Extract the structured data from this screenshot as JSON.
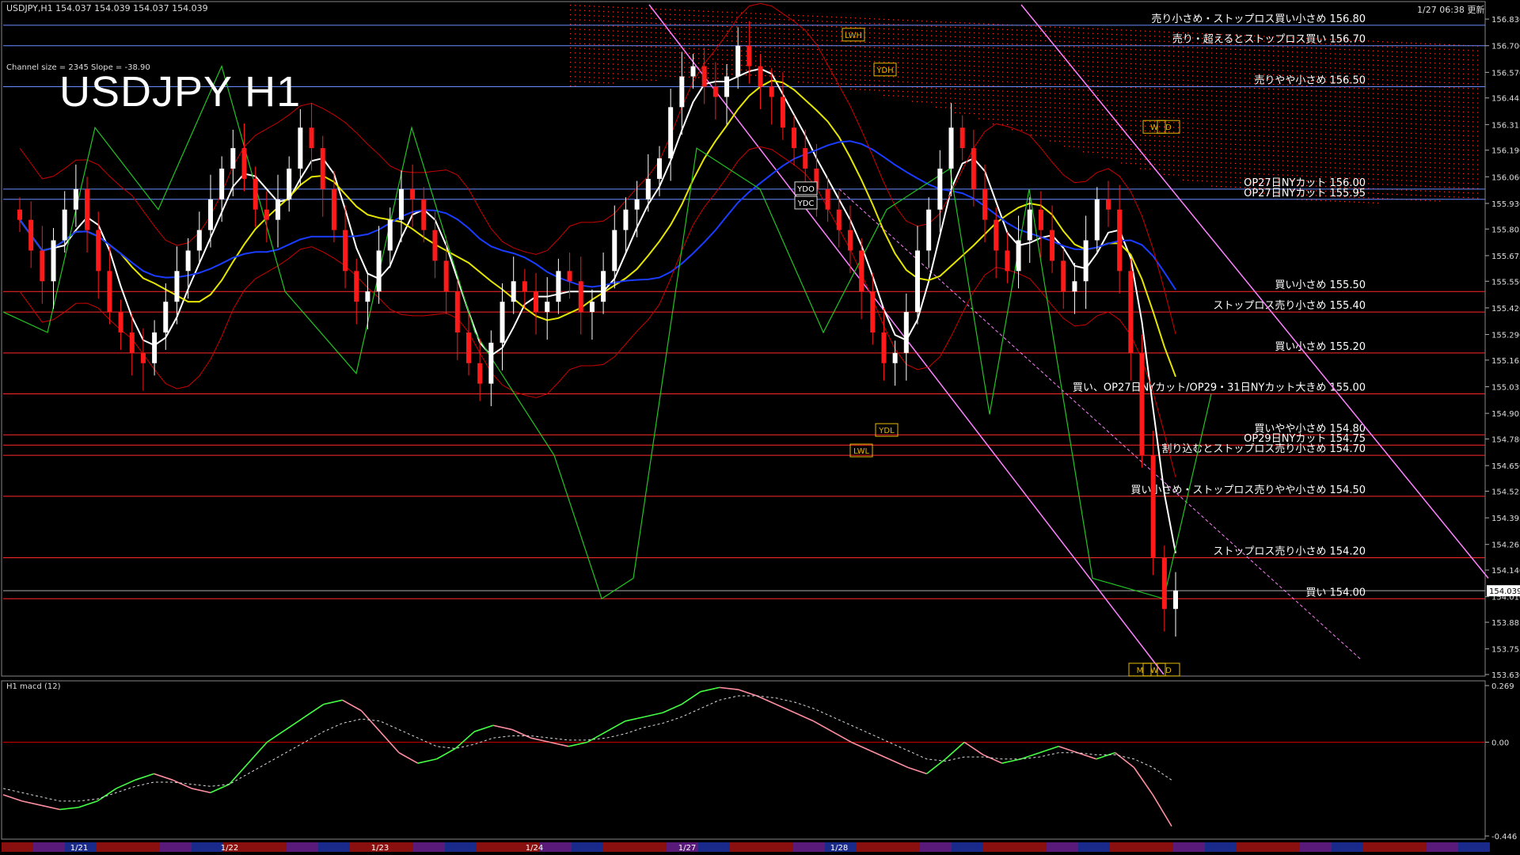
{
  "header": {
    "symbol_info": "USDJPY,H1  154.037 154.039 154.037 154.039",
    "channel_info": "Channel size = 2345 Slope = -38.90",
    "updated": "1/27 06:38 更新",
    "big_title": "USDJPY H1",
    "macd_title": "H1  macd (12)"
  },
  "colors": {
    "background": "#000000",
    "bull": "#ffffff",
    "bear": "#ff1a1a",
    "ichimoku_cloud": "#ff3020",
    "grid": "#1e3a78",
    "ma_white": "#ffffff",
    "ma_yellow": "#e6e600",
    "ma_blue": "#1a3cff",
    "bollinger": "#cc0000",
    "green_line": "#22c422",
    "channel": "#ff80ff",
    "macd_up": "#44ff44",
    "macd_down": "#ff8fa0"
  },
  "chart_data": {
    "type": "candlestick",
    "title": "USDJPY H1",
    "ylim": [
      153.63,
      156.9
    ],
    "y_ticks": [
      "156.830",
      "156.700",
      "156.570",
      "156.445",
      "156.315",
      "156.190",
      "156.060",
      "155.930",
      "155.805",
      "155.675",
      "155.550",
      "155.420",
      "155.290",
      "155.165",
      "155.035",
      "154.905",
      "154.780",
      "154.650",
      "154.525",
      "154.395",
      "154.265",
      "154.140",
      "154.010",
      "153.885",
      "153.755",
      "153.630"
    ],
    "current_price": "154.039",
    "x_labels": [
      "1/21",
      "1/22",
      "1/23",
      "1/24",
      "1/27",
      "1/28"
    ],
    "levels": [
      {
        "price": 156.8,
        "label": "売り小さめ・ストップロス買い小さめ 156.80",
        "color": "#6a8cff"
      },
      {
        "price": 156.7,
        "label": "売り・超えるとストップロス買い 156.70",
        "color": "#6a8cff"
      },
      {
        "price": 156.5,
        "label": "売りやや小さめ 156.50",
        "color": "#6a8cff"
      },
      {
        "price": 156.0,
        "label": "OP27日NYカット 156.00",
        "color": "#6a8cff"
      },
      {
        "price": 155.95,
        "label": "OP27日NYカット 155.95",
        "color": "#6a8cff"
      },
      {
        "price": 155.5,
        "label": "買い小さめ 155.50",
        "color": "#ff2a2a"
      },
      {
        "price": 155.4,
        "label": "ストップロス売り小さめ 155.40",
        "color": "#ff2a2a"
      },
      {
        "price": 155.2,
        "label": "買い小さめ 155.20",
        "color": "#ff2a2a"
      },
      {
        "price": 155.0,
        "label": "買い、OP27日NYカット/OP29・31日NYカット大きめ 155.00",
        "color": "#ff2a2a"
      },
      {
        "price": 154.8,
        "label": "買いやや小さめ 154.80",
        "color": "#ff2a2a"
      },
      {
        "price": 154.75,
        "label": "OP29日NYカット 154.75",
        "color": "#ff2a2a"
      },
      {
        "price": 154.7,
        "label": "割り込むとストップロス売り小さめ 154.70",
        "color": "#ff2a2a"
      },
      {
        "price": 154.5,
        "label": "買い小さめ・ストップロス売りやや小さめ 154.50",
        "color": "#ff2a2a"
      },
      {
        "price": 154.2,
        "label": "ストップロス売り小さめ 154.20",
        "color": "#ff2a2a"
      },
      {
        "price": 154.0,
        "label": "買い 154.00",
        "color": "#ff2a2a"
      }
    ],
    "markers": [
      "LWH",
      "YDH",
      "YDO",
      "YDC",
      "YDL",
      "LWL",
      "W",
      "D",
      "M",
      "W",
      "D"
    ],
    "series_closes": [
      155.85,
      155.7,
      155.55,
      155.75,
      155.9,
      156.0,
      155.8,
      155.6,
      155.4,
      155.3,
      155.2,
      155.15,
      155.3,
      155.45,
      155.6,
      155.7,
      155.8,
      155.95,
      156.1,
      156.2,
      156.05,
      155.9,
      155.85,
      155.95,
      156.1,
      156.3,
      156.2,
      156.0,
      155.8,
      155.6,
      155.45,
      155.5,
      155.7,
      155.85,
      156.0,
      155.95,
      155.8,
      155.65,
      155.5,
      155.3,
      155.15,
      155.05,
      155.25,
      155.45,
      155.55,
      155.5,
      155.4,
      155.45,
      155.6,
      155.55,
      155.4,
      155.45,
      155.6,
      155.8,
      155.9,
      155.95,
      156.05,
      156.15,
      156.4,
      156.55,
      156.6,
      156.5,
      156.45,
      156.55,
      156.7,
      156.6,
      156.5,
      156.45,
      156.3,
      156.2,
      156.1,
      156.0,
      155.9,
      155.8,
      155.7,
      155.5,
      155.3,
      155.15,
      155.2,
      155.4,
      155.7,
      155.9,
      156.1,
      156.3,
      156.2,
      156.0,
      155.85,
      155.7,
      155.6,
      155.75,
      155.9,
      155.8,
      155.65,
      155.5,
      155.55,
      155.75,
      155.95,
      155.9,
      155.6,
      155.2,
      154.7,
      154.2,
      153.95,
      154.04
    ],
    "macd": {
      "ylim": [
        -0.446,
        0.269
      ],
      "y_ticks": [
        "0.269",
        "0.00",
        "-0.446"
      ],
      "values": [
        -0.25,
        -0.28,
        -0.3,
        -0.32,
        -0.31,
        -0.28,
        -0.22,
        -0.18,
        -0.15,
        -0.18,
        -0.22,
        -0.24,
        -0.2,
        -0.1,
        0.0,
        0.06,
        0.12,
        0.18,
        0.2,
        0.15,
        0.05,
        -0.05,
        -0.1,
        -0.08,
        -0.03,
        0.05,
        0.08,
        0.06,
        0.02,
        0.0,
        -0.02,
        0.0,
        0.05,
        0.1,
        0.12,
        0.14,
        0.18,
        0.24,
        0.26,
        0.25,
        0.22,
        0.18,
        0.14,
        0.1,
        0.05,
        0.0,
        -0.04,
        -0.08,
        -0.12,
        -0.15,
        -0.08,
        0.0,
        -0.06,
        -0.1,
        -0.08,
        -0.05,
        -0.02,
        -0.05,
        -0.08,
        -0.05,
        -0.12,
        -0.25,
        -0.4
      ],
      "signal": [
        -0.22,
        -0.24,
        -0.26,
        -0.28,
        -0.28,
        -0.27,
        -0.24,
        -0.21,
        -0.19,
        -0.19,
        -0.2,
        -0.21,
        -0.2,
        -0.15,
        -0.1,
        -0.05,
        0.0,
        0.05,
        0.09,
        0.11,
        0.1,
        0.06,
        0.02,
        -0.02,
        -0.03,
        -0.01,
        0.02,
        0.03,
        0.03,
        0.02,
        0.01,
        0.01,
        0.02,
        0.04,
        0.07,
        0.09,
        0.12,
        0.16,
        0.2,
        0.22,
        0.22,
        0.21,
        0.19,
        0.16,
        0.12,
        0.08,
        0.04,
        0.0,
        -0.04,
        -0.08,
        -0.09,
        -0.07,
        -0.07,
        -0.08,
        -0.08,
        -0.07,
        -0.05,
        -0.05,
        -0.06,
        -0.06,
        -0.08,
        -0.12,
        -0.18
      ]
    }
  }
}
